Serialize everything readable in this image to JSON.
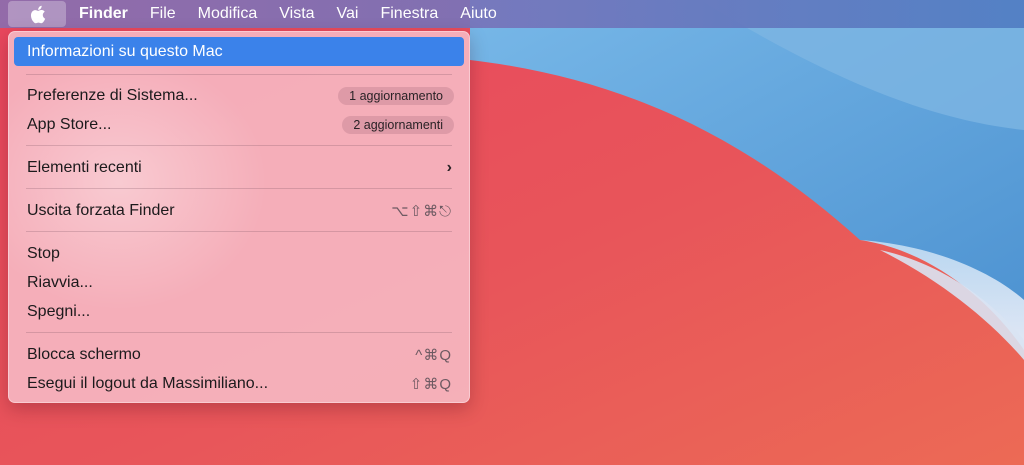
{
  "menubar": {
    "app_name": "Finder",
    "items": [
      "File",
      "Modifica",
      "Vista",
      "Vai",
      "Finestra",
      "Aiuto"
    ]
  },
  "apple_menu": {
    "about": "Informazioni su questo Mac",
    "system_prefs": {
      "label": "Preferenze di Sistema...",
      "badge": "1 aggiornamento"
    },
    "app_store": {
      "label": "App Store...",
      "badge": "2 aggiornamenti"
    },
    "recent_items": {
      "label": "Elementi recenti",
      "submenu_glyph": "›"
    },
    "force_quit": {
      "label": "Uscita forzata Finder",
      "shortcut": "⌥⇧⌘⎋"
    },
    "stop": "Stop",
    "restart": "Riavvia...",
    "shutdown": "Spegni...",
    "lock_screen": {
      "label": "Blocca schermo",
      "shortcut": "^⌘Q"
    },
    "logout": {
      "label": "Esegui il logout da Massimiliano...",
      "shortcut": "⇧⌘Q"
    }
  },
  "colors": {
    "selection": "#3b82ea",
    "wallpaper_red": "#e8505a",
    "wallpaper_blue": "#5a9fd6"
  }
}
